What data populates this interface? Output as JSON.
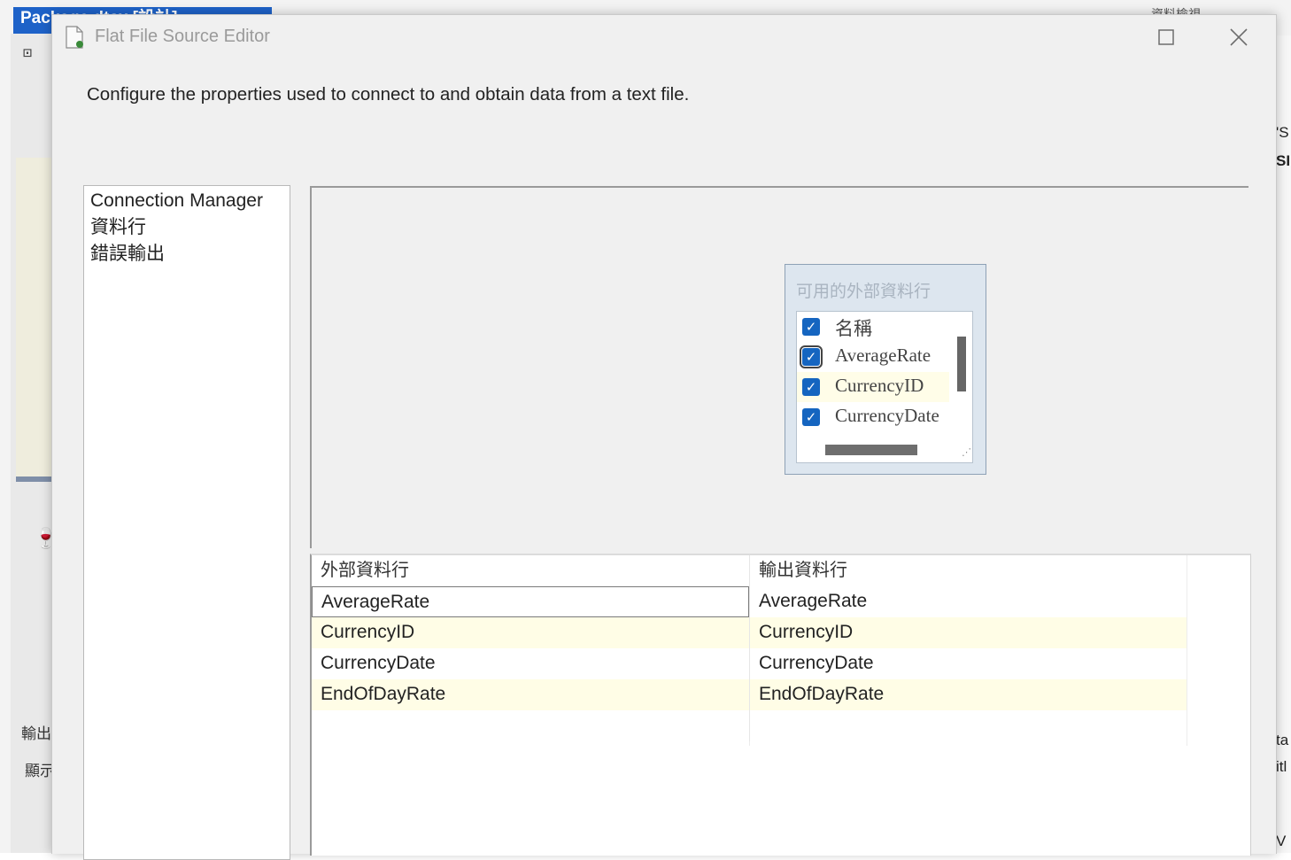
{
  "background": {
    "tab_title": "Package.dtsx [設計]",
    "top_right_text": "資料檢視",
    "output_label": "輸出",
    "display_label": "顯示",
    "right_fragments": [
      "'S",
      "SI",
      "ta",
      "itl",
      "V"
    ]
  },
  "dialog": {
    "title": "Flat File Source Editor",
    "description": "Configure the properties used to connect to and obtain data from a text file."
  },
  "nav": {
    "items": [
      "Connection Manager",
      "資料行",
      "錯誤輸出"
    ]
  },
  "available_columns": {
    "title": "可用的外部資料行",
    "items": [
      {
        "label": "名稱",
        "checked": true
      },
      {
        "label": "AverageRate",
        "checked": true
      },
      {
        "label": "CurrencyID",
        "checked": true
      },
      {
        "label": "CurrencyDate",
        "checked": true
      }
    ]
  },
  "mapping_grid": {
    "headers": [
      "外部資料行",
      "輸出資料行"
    ],
    "rows": [
      {
        "external": "AverageRate",
        "output": "AverageRate"
      },
      {
        "external": "CurrencyID",
        "output": "CurrencyID"
      },
      {
        "external": "CurrencyDate",
        "output": "CurrencyDate"
      },
      {
        "external": "EndOfDayRate",
        "output": "EndOfDayRate"
      }
    ]
  },
  "colors": {
    "accent": "#1565c0",
    "row_highlight": "#fffde6",
    "tab_blue": "#1e62c8"
  }
}
